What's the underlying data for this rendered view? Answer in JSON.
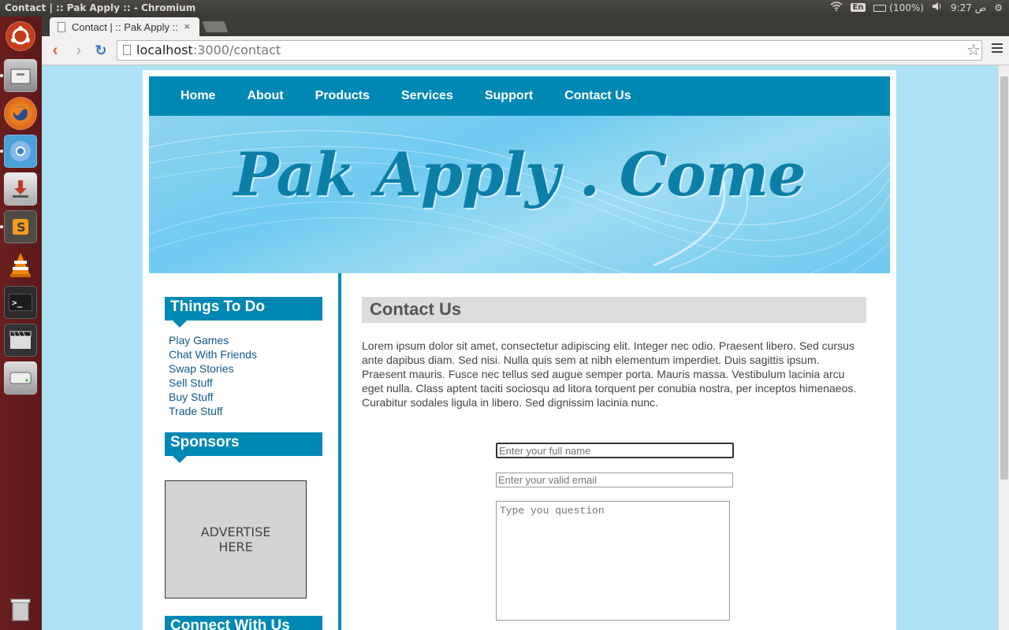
{
  "os": {
    "window_title": "Contact | :: Pak Apply :: - Chromium",
    "language": "En",
    "battery": "(100%)",
    "clock": "9:27 ص"
  },
  "launcher": {
    "items": [
      "ubuntu-dash-icon",
      "files-icon",
      "firefox-icon",
      "chromium-icon",
      "installer-icon",
      "sublime-text-icon",
      "vlc-icon",
      "terminal-icon",
      "video-editor-icon",
      "disk-icon",
      "trash-icon"
    ]
  },
  "browser": {
    "tab_title": "Contact | :: Pak Apply ::",
    "url_host": "localhost",
    "url_path": ":3000/contact"
  },
  "site": {
    "nav": [
      "Home",
      "About",
      "Products",
      "Services",
      "Support",
      "Contact Us"
    ],
    "logo": "Pak Apply . Come",
    "sidebar": {
      "things_title": "Things To Do",
      "things": [
        "Play Games",
        "Chat With Friends",
        "Swap Stories",
        "Sell Stuff",
        "Buy Stuff",
        "Trade Stuff"
      ],
      "sponsors_title": "Sponsors",
      "ad_line1": "ADVERTISE",
      "ad_line2": "HERE",
      "connect_title": "Connect With Us"
    },
    "content": {
      "title": "Contact Us",
      "body": "Lorem ipsum dolor sit amet, consectetur adipiscing elit. Integer nec odio. Praesent libero. Sed cursus ante dapibus diam. Sed nisi. Nulla quis sem at nibh elementum imperdiet. Duis sagittis ipsum. Praesent mauris. Fusce nec tellus sed augue semper porta. Mauris massa. Vestibulum lacinia arcu eget nulla. Class aptent taciti sociosqu ad litora torquent per conubia nostra, per inceptos himenaeos. Curabitur sodales ligula in libero. Sed dignissim lacinia nunc.",
      "name_placeholder": "Enter your full name",
      "email_placeholder": "Enter your valid email",
      "question_placeholder": "Type you question"
    }
  }
}
